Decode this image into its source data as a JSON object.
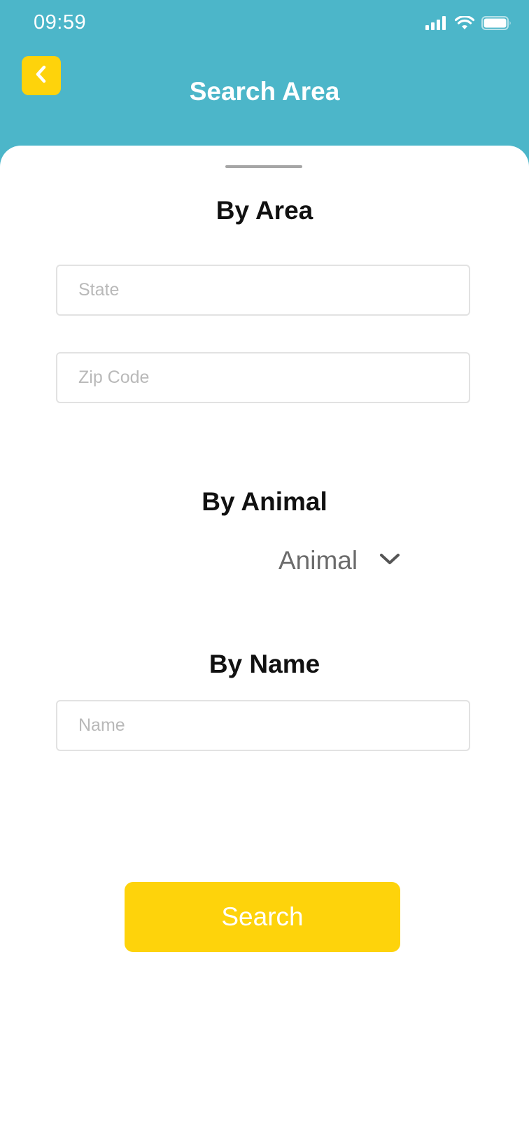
{
  "status_bar": {
    "time": "09:59"
  },
  "header": {
    "title": "Search Area",
    "back_icon": "chevron-left-icon"
  },
  "sections": {
    "area": {
      "title": "By Area",
      "state_placeholder": "State",
      "state_value": "",
      "zip_placeholder": "Zip Code",
      "zip_value": ""
    },
    "animal": {
      "title": "By Animal",
      "select_label": "Animal",
      "select_icon": "chevron-down-icon"
    },
    "name": {
      "title": "By Name",
      "name_placeholder": "Name",
      "name_value": ""
    }
  },
  "actions": {
    "search_label": "Search"
  },
  "colors": {
    "header_bg": "#4cb6c9",
    "accent": "#fed30b",
    "sheet_bg": "#ffffff"
  }
}
